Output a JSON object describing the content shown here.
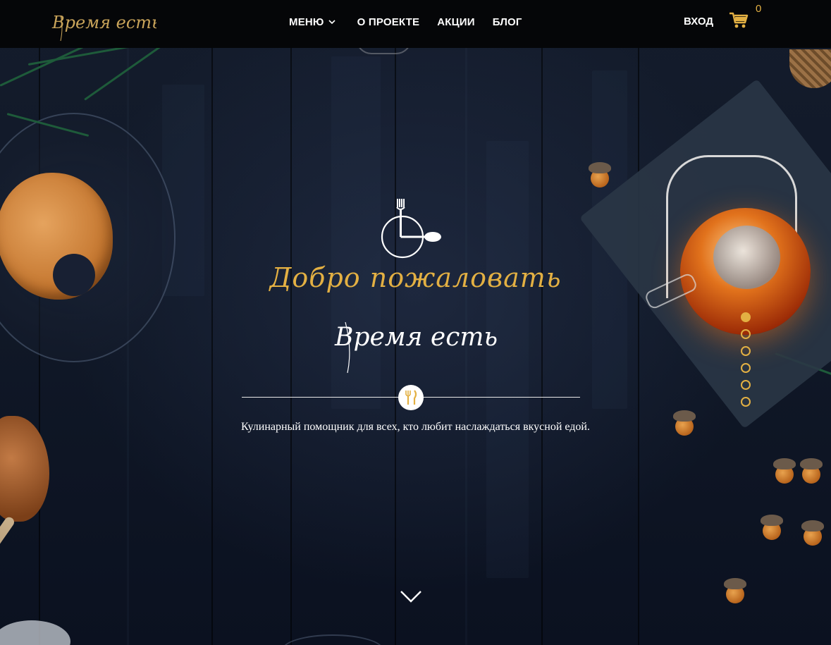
{
  "header": {
    "logo_text": "Время есть",
    "nav": {
      "menu": "МЕНЮ",
      "about": "О ПРОЕКТЕ",
      "promotions": "АКЦИИ",
      "blog": "БЛОГ"
    },
    "login": "ВХОД",
    "cart_count": "0"
  },
  "hero": {
    "welcome": "Добро пожаловать",
    "script_logo_text": "Время есть",
    "tagline": "Кулинарный помощник для всех, кто любит наслаждаться вкусной едой.",
    "slider": {
      "count": 6,
      "active_index": 0
    }
  },
  "colors": {
    "accent": "#e3b043",
    "header_bg": "#050608",
    "background": "#101827",
    "text": "#ffffff"
  },
  "icons": [
    "chevron-down-icon",
    "cart-icon",
    "fork-clock-spoon-icon",
    "fork-knife-icon",
    "chevron-down-large-icon"
  ]
}
